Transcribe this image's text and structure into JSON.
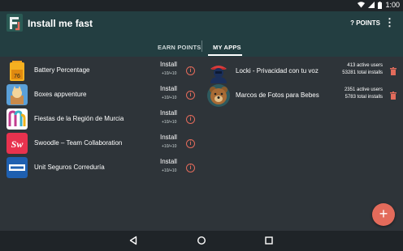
{
  "status_bar": {
    "time": "1:00",
    "icons": [
      "wifi-icon",
      "signal-icon",
      "battery-icon"
    ]
  },
  "app_bar": {
    "title": "Install me fast",
    "points_label": "? POINTS",
    "overflow_icon": "more-vert-icon"
  },
  "tabs": [
    {
      "label": "EARN POINTS",
      "active": false
    },
    {
      "label": "MY APPS",
      "active": true
    }
  ],
  "earn_list": [
    {
      "name": "Battery Percentage",
      "action": "Install",
      "reward": "+10/+10",
      "icon": "battery-app-icon"
    },
    {
      "name": "Boxes appventure",
      "action": "Install",
      "reward": "+10/+10",
      "icon": "boxes-app-icon"
    },
    {
      "name": "Fiestas de la Región de Murcia",
      "action": "Install",
      "reward": "+10/+10",
      "icon": "murcia-app-icon"
    },
    {
      "name": "Swoodle – Team Collaboration",
      "action": "Install",
      "reward": "+10/+10",
      "icon": "swoodle-app-icon"
    },
    {
      "name": "Unit Seguros Correduría",
      "action": "Install",
      "reward": "+10/+10",
      "icon": "unit-app-icon"
    }
  ],
  "my_apps": [
    {
      "name": "Locki - Privacidad con tu voz",
      "active_users": "413 active users",
      "total_installs": "53281 total installs",
      "icon": "locki-app-icon"
    },
    {
      "name": "Marcos de Fotos para Bebes",
      "active_users": "2351 active users",
      "total_installs": "5783 total installs",
      "icon": "teddy-bear-app-icon"
    }
  ],
  "fab": {
    "label": "+"
  },
  "colors": {
    "accent": "#e36b5b",
    "app_bar": "#233e41",
    "background": "#2e3439"
  }
}
